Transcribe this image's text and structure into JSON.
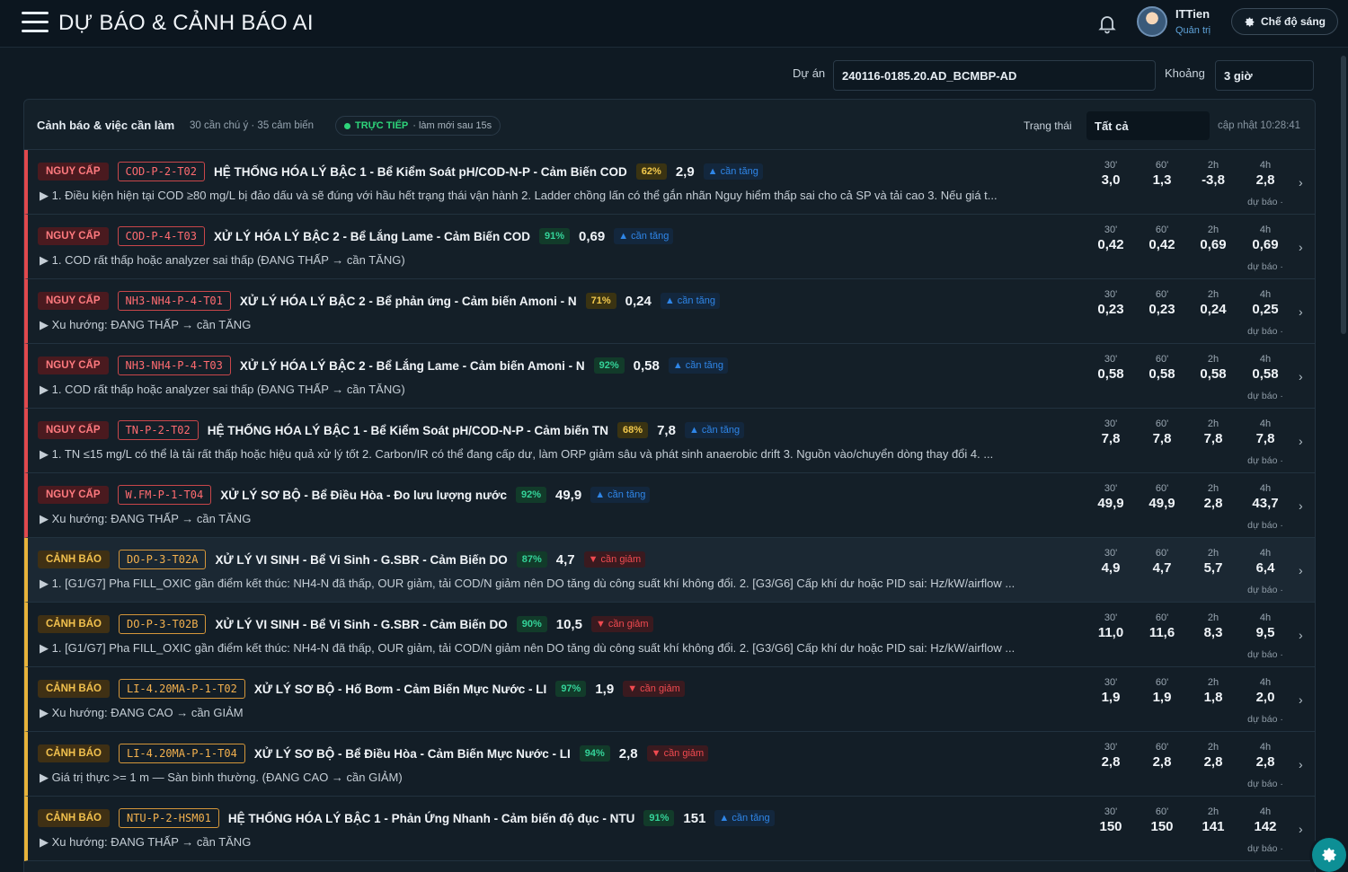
{
  "header": {
    "title": "DỰ BÁO & CẢNH BÁO AI",
    "user_name": "ITTien",
    "user_role": "Quản trị",
    "mode_label": "Chế độ sáng"
  },
  "filters": {
    "project_label": "Dự án",
    "project_value": "240116-0185.20.AD_BCMBP-AD",
    "range_label": "Khoảng",
    "range_value": "3 giờ"
  },
  "panel": {
    "title": "Cảnh báo & việc cần làm",
    "subtitle": "30 cần chú ý · 35 cảm biến",
    "live_label": "TRỰC TIẾP",
    "live_refresh": "· làm mới sau 15s",
    "status_label": "Trạng thái",
    "status_value": "Tất cả",
    "updated": "cập nhật 10:28:41"
  },
  "colors": {
    "danger": "#e0484d",
    "warning": "#e8b33a",
    "up": "#2f86e8",
    "down": "#f04a50",
    "confidence": "#34d399"
  },
  "rows": [
    {
      "severity": "NGUY CẤP",
      "code": "COD-P-2-T02",
      "title": "HỆ THỐNG HÓA LÝ BẬC 1 - Bể Kiểm Soát pH/COD-N-P - Cảm Biến COD",
      "confidence": "62%",
      "value": "2,9",
      "trend": "▲ cần tăng",
      "desc": "▶ 1. Điều kiện hiện tại COD ≥80 mg/L bị đảo dấu và sẽ đúng với hầu hết trạng thái vận hành 2. Ladder chồng lấn có thể gắn nhãn Nguy hiểm thấp sai cho cả SP và tải cao 3. Nếu giá t...",
      "f30": "3,0",
      "f60": "1,3",
      "f2h": "-3,8",
      "f4h": "2,8"
    },
    {
      "severity": "NGUY CẤP",
      "code": "COD-P-4-T03",
      "title": "XỬ LÝ HÓA LÝ BẬC 2 - Bể Lắng Lame - Cảm Biến COD",
      "confidence": "91%",
      "value": "0,69",
      "trend": "▲ cần tăng",
      "desc": "▶ 1. COD rất thấp hoặc analyzer sai thấp (ĐANG THẤP → cần TĂNG)",
      "f30": "0,42",
      "f60": "0,42",
      "f2h": "0,69",
      "f4h": "0,69"
    },
    {
      "severity": "NGUY CẤP",
      "code": "NH3-NH4-P-4-T01",
      "title": "XỬ LÝ HÓA LÝ BẬC 2 - Bể phản ứng - Cảm biến Amoni - N",
      "confidence": "71%",
      "value": "0,24",
      "trend": "▲ cần tăng",
      "desc": "▶ Xu hướng: ĐANG THẤP → cần TĂNG",
      "f30": "0,23",
      "f60": "0,23",
      "f2h": "0,24",
      "f4h": "0,25"
    },
    {
      "severity": "NGUY CẤP",
      "code": "NH3-NH4-P-4-T03",
      "title": "XỬ LÝ HÓA LÝ BẬC 2 - Bể Lắng Lame - Cảm biến Amoni - N",
      "confidence": "92%",
      "value": "0,58",
      "trend": "▲ cần tăng",
      "desc": "▶ 1. COD rất thấp hoặc analyzer sai thấp (ĐANG THẤP → cần TĂNG)",
      "f30": "0,58",
      "f60": "0,58",
      "f2h": "0,58",
      "f4h": "0,58"
    },
    {
      "severity": "NGUY CẤP",
      "code": "TN-P-2-T02",
      "title": "HỆ THỐNG HÓA LÝ BẬC 1 - Bể Kiểm Soát pH/COD-N-P - Cảm biến TN",
      "confidence": "68%",
      "value": "7,8",
      "trend": "▲ cần tăng",
      "desc": "▶ 1. TN ≤15 mg/L có thể là tải rất thấp hoặc hiệu quả xử lý tốt 2. Carbon/IR có thể đang cấp dư, làm ORP giảm sâu và phát sinh anaerobic drift 3. Nguồn vào/chuyển dòng thay đổi 4. ...",
      "f30": "7,8",
      "f60": "7,8",
      "f2h": "7,8",
      "f4h": "7,8"
    },
    {
      "severity": "NGUY CẤP",
      "code": "W.FM-P-1-T04",
      "title": "XỬ LÝ SƠ BỘ - Bể Điều Hòa - Đo lưu lượng nước",
      "confidence": "92%",
      "value": "49,9",
      "trend": "▲ cần tăng",
      "desc": "▶ Xu hướng: ĐANG THẤP → cần TĂNG",
      "f30": "49,9",
      "f60": "49,9",
      "f2h": "2,8",
      "f4h": "43,7"
    },
    {
      "severity": "CẢNH BÁO",
      "code": "DO-P-3-T02A",
      "title": "XỬ LÝ VI SINH - Bể Vi Sinh - G.SBR - Cảm Biến DO",
      "confidence": "87%",
      "value": "4,7",
      "trend": "▼ cần giảm",
      "desc": "▶ 1. [G1/G7] Pha FILL_OXIC gần điểm kết thúc: NH4-N đã thấp, OUR giảm, tải COD/N giảm nên DO tăng dù công suất khí không đổi. 2. [G3/G6] Cấp khí dư hoặc PID sai: Hz/kW/airflow ...",
      "f30": "4,9",
      "f60": "4,7",
      "f2h": "5,7",
      "f4h": "6,4"
    },
    {
      "severity": "CẢNH BÁO",
      "code": "DO-P-3-T02B",
      "title": "XỬ LÝ VI SINH - Bể Vi Sinh - G.SBR - Cảm Biến DO",
      "confidence": "90%",
      "value": "10,5",
      "trend": "▼ cần giảm",
      "desc": "▶ 1. [G1/G7] Pha FILL_OXIC gần điểm kết thúc: NH4-N đã thấp, OUR giảm, tải COD/N giảm nên DO tăng dù công suất khí không đổi. 2. [G3/G6] Cấp khí dư hoặc PID sai: Hz/kW/airflow ...",
      "f30": "11,0",
      "f60": "11,6",
      "f2h": "8,3",
      "f4h": "9,5"
    },
    {
      "severity": "CẢNH BÁO",
      "code": "LI-4.20MA-P-1-T02",
      "title": "XỬ LÝ SƠ BỘ - Hố Bơm - Cảm Biến Mực Nước - LI",
      "confidence": "97%",
      "value": "1,9",
      "trend": "▼ cần giảm",
      "desc": "▶ Xu hướng: ĐANG CAO → cần GIẢM",
      "f30": "1,9",
      "f60": "1,9",
      "f2h": "1,8",
      "f4h": "2,0"
    },
    {
      "severity": "CẢNH BÁO",
      "code": "LI-4.20MA-P-1-T04",
      "title": "XỬ LÝ SƠ BỘ - Bể Điều Hòa - Cảm Biến Mực Nước - LI",
      "confidence": "94%",
      "value": "2,8",
      "trend": "▼ cần giảm",
      "desc": "▶ Giá trị thực >= 1 m — Sàn bình thường. (ĐANG CAO → cần GIẢM)",
      "f30": "2,8",
      "f60": "2,8",
      "f2h": "2,8",
      "f4h": "2,8"
    },
    {
      "severity": "CẢNH BÁO",
      "code": "NTU-P-2-HSM01",
      "title": "HỆ THỐNG HÓA LÝ BẬC 1 - Phản Ứng Nhanh - Cảm biến độ đục - NTU",
      "confidence": "91%",
      "value": "151",
      "trend": "▲ cần tăng",
      "desc": "▶ Xu hướng: ĐANG THẤP → cần TĂNG",
      "f30": "150",
      "f60": "150",
      "f2h": "141",
      "f4h": "142"
    }
  ],
  "forecast_labels": {
    "m30": "30'",
    "m60": "60'",
    "h2": "2h",
    "h4": "4h",
    "caption": "dự báo ·"
  }
}
